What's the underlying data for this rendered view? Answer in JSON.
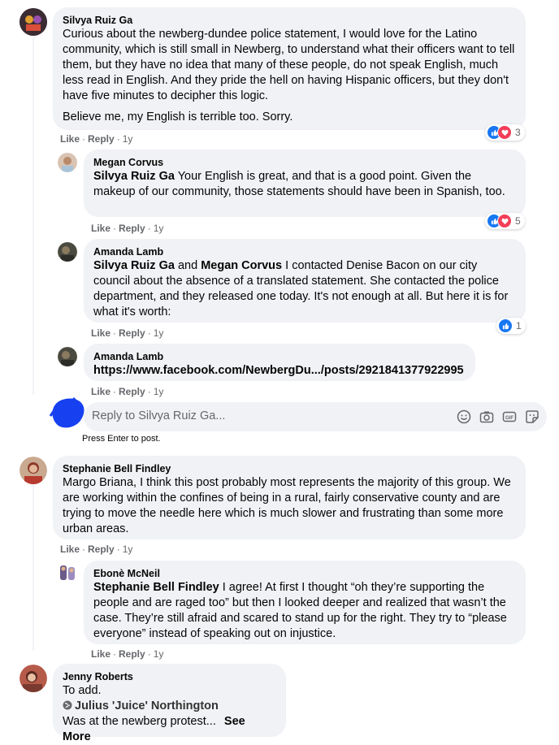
{
  "actions": {
    "like": "Like",
    "reply": "Reply",
    "dot": "·"
  },
  "comments": [
    {
      "author": "Silvya Ruiz Ga",
      "paragraph1": "Curious about the newberg-dundee police statement, I would love for the Latino community, which is still small in Newberg, to understand what their officers want to tell them, but they have no idea that many of these people, do not speak English, much less read in English. And they pride the hell on having Hispanic officers, but they don't have five minutes to decipher this logic.",
      "paragraph2": "Believe me, my English is terrible too. Sorry.",
      "time": "1y",
      "reactions": "3"
    },
    {
      "author": "Megan Corvus",
      "mention": "Silvya Ruiz Ga",
      "text": " Your English is great, and that is a good point. Given the makeup of our community, those statements should have been in Spanish, too.",
      "time": "1y",
      "reactions": "5"
    },
    {
      "author": "Amanda Lamb",
      "mention1": "Silvya Ruiz Ga",
      "joiner": " and ",
      "mention2": "Megan Corvus",
      "text": " I contacted Denise Bacon on our city council about the absence of a translated statement. She contacted the police department, and they released one today. It's not enough at all. But here it is for what it's worth:",
      "time": "1y",
      "reactions": "1"
    },
    {
      "author": "Amanda Lamb",
      "link": "https://www.facebook.com/NewbergDu.../posts/2921841377922995",
      "time": "1y"
    },
    {
      "author": "Stephanie Bell Findley",
      "text": "Margo Briana, I think this post probably most represents the majority of this group. We are working within the confines of being in a rural, fairly conservative county and are trying to move the needle here which is much slower and frustrating than some more urban areas.",
      "time": "1y"
    },
    {
      "author": "Ebonè McNeil",
      "mention": "Stephanie Bell Findley",
      "text": " I agree! At first I thought “oh they’re supporting the people and are raged too” but then I looked deeper and realized that wasn’t the case. They’re still afraid and scared to stand up for the right. They try to “please everyone” instead of speaking out on injustice.",
      "time": "1y"
    },
    {
      "author": "Jenny Roberts",
      "text": "To add.",
      "shared": "Julius 'Juice' Northington",
      "preview": "Was at the newberg protest...",
      "see_more": "See More"
    }
  ],
  "reply_box": {
    "placeholder": "Reply to Silvya Ruiz Ga...",
    "hint": "Press Enter to post."
  },
  "colors": {
    "bubble": "#f0f2f5",
    "like_blue": "#1877f2",
    "love_red": "#f33e58",
    "meta_gray": "#65676b",
    "scribble": "#1640f0"
  }
}
